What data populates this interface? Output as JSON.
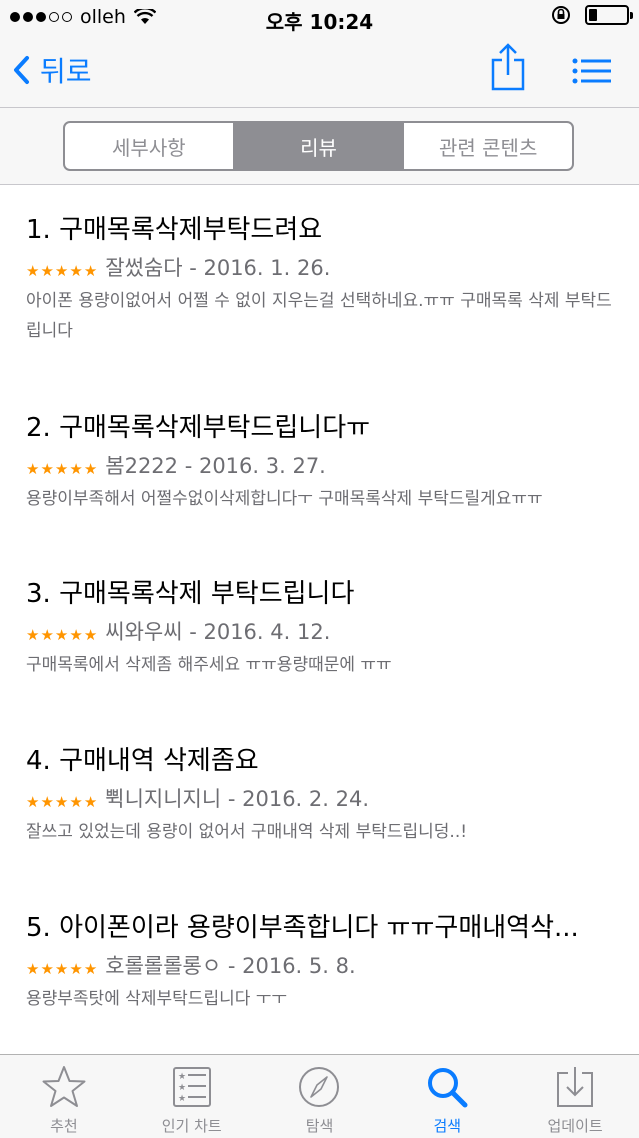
{
  "status_bar": {
    "carrier": "olleh",
    "time": "오후 10:24"
  },
  "nav": {
    "back_label": "뒤로"
  },
  "segments": [
    {
      "label": "세부사항",
      "active": false
    },
    {
      "label": "리뷰",
      "active": true
    },
    {
      "label": "관련 콘텐츠",
      "active": false
    }
  ],
  "reviews": [
    {
      "title": "1. 구매목록삭제부탁드려요",
      "rating": 5,
      "meta": "잘썼숨다 - 2016. 1. 26.",
      "body": "아이폰 용량이없어서 어쩔 수 없이 지우는걸 선택하네요.ㅠㅠ 구매목록 삭제 부탁드립니다"
    },
    {
      "title": "2. 구매목록삭제부탁드립니다ㅠ",
      "rating": 5,
      "meta": "봄2222 - 2016. 3. 27.",
      "body": "용량이부족해서 어쩔수없이삭제합니다ㅜ 구매목록삭제 부탁드릴게요ㅠㅠ"
    },
    {
      "title": "3. 구매목록삭제 부탁드립니다",
      "rating": 5,
      "meta": "씨와우씨 - 2016. 4. 12.",
      "body": "구매목록에서 삭제좀 해주세요 ㅠㅠ용량때문에 ㅠㅠ"
    },
    {
      "title": "4. 구매내역 삭제좀요",
      "rating": 5,
      "meta": "쀡니지니지니 - 2016. 2. 24.",
      "body": "잘쓰고 있었는데 용량이 없어서 구매내역 삭제 부탁드립니덩..!"
    },
    {
      "title": "5. 아이폰이라 용량이부족합니다 ㅠㅠ구매내역삭...",
      "rating": 5,
      "meta": "호롤롤롤롱ㅇ - 2016. 5. 8.",
      "body": "용량부족탓에 삭제부탁드립니다 ㅜㅜ"
    }
  ],
  "tabs": [
    {
      "label": "추천",
      "icon": "star-icon"
    },
    {
      "label": "인기 차트",
      "icon": "top-charts-icon"
    },
    {
      "label": "탐색",
      "icon": "compass-icon"
    },
    {
      "label": "검색",
      "icon": "search-icon",
      "active": true
    },
    {
      "label": "업데이트",
      "icon": "updates-icon"
    }
  ],
  "colors": {
    "accent": "#0a7cff",
    "star": "#ff9500",
    "secondary_text": "#6d6d72",
    "segment_gray": "#8e8e93"
  }
}
